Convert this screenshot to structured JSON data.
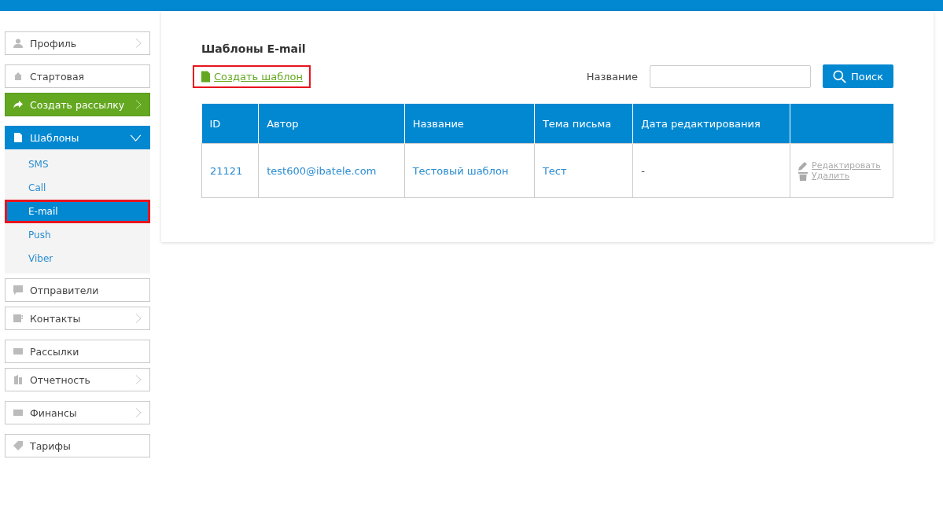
{
  "sidebar": {
    "groups": [
      {
        "items": [
          {
            "label": "Профиль",
            "kind": "plain",
            "expandable": true
          }
        ]
      },
      {
        "items": [
          {
            "label": "Стартовая",
            "kind": "plain",
            "expandable": false
          },
          {
            "label": "Создать рассылку",
            "kind": "accent",
            "expandable": true
          }
        ]
      },
      {
        "items": [
          {
            "label": "Шаблоны",
            "kind": "active",
            "expandable": true,
            "expanded": true,
            "children": [
              {
                "label": "SMS",
                "selected": false,
                "highlighted": false
              },
              {
                "label": "Call",
                "selected": false,
                "highlighted": false
              },
              {
                "label": "E-mail",
                "selected": true,
                "highlighted": true
              },
              {
                "label": "Push",
                "selected": false,
                "highlighted": false
              },
              {
                "label": "Viber",
                "selected": false,
                "highlighted": false
              }
            ]
          },
          {
            "label": "Отправители",
            "kind": "plain",
            "expandable": false
          },
          {
            "label": "Контакты",
            "kind": "plain",
            "expandable": true
          }
        ]
      },
      {
        "items": [
          {
            "label": "Рассылки",
            "kind": "plain",
            "expandable": false
          },
          {
            "label": "Отчетность",
            "kind": "plain",
            "expandable": true
          }
        ]
      },
      {
        "items": [
          {
            "label": "Финансы",
            "kind": "plain",
            "expandable": true
          }
        ]
      },
      {
        "items": [
          {
            "label": "Тарифы",
            "kind": "plain",
            "expandable": false
          }
        ]
      }
    ]
  },
  "main": {
    "title": "Шаблоны E-mail",
    "create_link": {
      "label": "Создать шаблон",
      "highlighted": true
    },
    "search": {
      "label": "Название",
      "button": "Поиск"
    },
    "table": {
      "columns": [
        "ID",
        "Автор",
        "Название",
        "Тема письма",
        "Дата редактирования"
      ],
      "rows": [
        {
          "cells": [
            "21121",
            "test600@ibatele.com",
            "Тестовый шаблон",
            "Тест",
            "-"
          ],
          "actions": [
            "Редактировать",
            "Удалить"
          ]
        }
      ]
    }
  }
}
